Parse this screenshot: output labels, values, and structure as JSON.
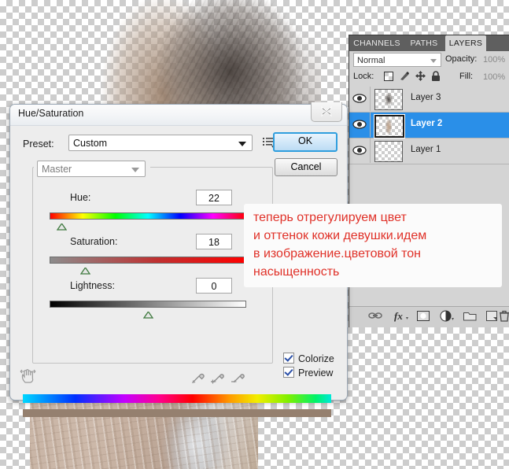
{
  "canvas": {
    "checkerboard": true,
    "photo_alt": "desaturated portrait of a girl with braided hair wearing a knit sweater"
  },
  "dialog": {
    "title": "Hue/Saturation",
    "close_icon": "close-x-icon",
    "preset": {
      "label": "Preset:",
      "value": "Custom",
      "caret_icon": "chevron-down-icon",
      "menu_icon": "preset-options-icon"
    },
    "buttons": {
      "ok": "OK",
      "cancel": "Cancel"
    },
    "channel": {
      "value": "Master",
      "caret_icon": "chevron-down-icon"
    },
    "sliders": [
      {
        "name": "hue",
        "label": "Hue:",
        "value": "22",
        "thumb_percent": 6
      },
      {
        "name": "saturation",
        "label": "Saturation:",
        "value": "18",
        "thumb_percent": 18
      },
      {
        "name": "lightness",
        "label": "Lightness:",
        "value": "0",
        "thumb_percent": 50
      }
    ],
    "hand_icon": "on-image-adjust-hand-icon",
    "eyedroppers": [
      {
        "name": "eyedropper-sample-icon"
      },
      {
        "name": "eyedropper-add-icon"
      },
      {
        "name": "eyedropper-subtract-icon"
      }
    ],
    "checkboxes": [
      {
        "name": "colorize",
        "label": "Colorize",
        "checked": true
      },
      {
        "name": "preview",
        "label": "Preview",
        "checked": true
      }
    ],
    "result_color": "#95806f"
  },
  "panel": {
    "tabs": [
      {
        "id": "channels",
        "label": "CHANNELS",
        "active": false
      },
      {
        "id": "paths",
        "label": "PATHS",
        "active": false
      },
      {
        "id": "layers",
        "label": "LAYERS",
        "active": true
      }
    ],
    "blend_mode": "Normal",
    "opacity_label": "Opacity:",
    "opacity_value": "100%",
    "lock_label": "Lock:",
    "lock_icons": [
      "lock-transparent-pixels-icon",
      "lock-image-pixels-icon",
      "lock-position-icon",
      "lock-all-icon"
    ],
    "fill_label": "Fill:",
    "fill_value": "100%",
    "layers": [
      {
        "name": "Layer 3",
        "visible": true,
        "selected": false,
        "eye_icon": "eye-icon"
      },
      {
        "name": "Layer 2",
        "visible": true,
        "selected": true,
        "eye_icon": "eye-icon"
      },
      {
        "name": "Layer 1",
        "visible": true,
        "selected": false,
        "eye_icon": "eye-icon"
      }
    ],
    "footer_icons": [
      "link-layers-icon",
      "layer-style-fx-icon",
      "add-layer-mask-icon",
      "new-adjustment-layer-icon",
      "new-group-icon",
      "new-layer-icon",
      "delete-layer-icon"
    ],
    "selection_color": "#2a8fe8"
  },
  "annotation": {
    "color": "#e03128",
    "lines": [
      "теперь отрегулируем цвет",
      "и оттенок кожи девушки.идем",
      "в изображение.цветовой тон",
      "насыщенность"
    ]
  }
}
